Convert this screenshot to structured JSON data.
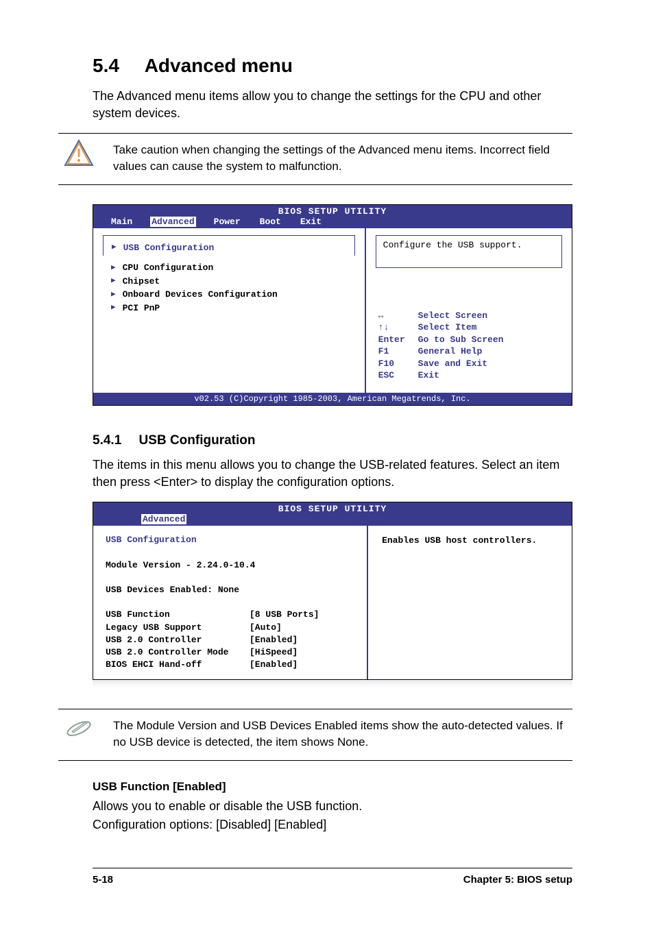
{
  "heading": {
    "num": "5.4",
    "title": "Advanced menu"
  },
  "intro": "The Advanced menu items allow you to change the settings for the CPU and other system devices.",
  "caution": "Take caution when changing the settings of the Advanced menu items. Incorrect field values can cause the system to malfunction.",
  "bios1": {
    "title": "BIOS SETUP UTILITY",
    "tabs": [
      "Main",
      "Advanced",
      "Power",
      "Boot",
      "Exit"
    ],
    "active_tab": "Advanced",
    "items": [
      "USB Configuration",
      "CPU Configuration",
      "Chipset",
      "Onboard Devices Configuration",
      "PCI PnP"
    ],
    "help_text": "Configure the USB support.",
    "keys": [
      {
        "k": "↔",
        "v": "Select Screen"
      },
      {
        "k": "↑↓",
        "v": "Select Item"
      },
      {
        "k": "Enter",
        "v": "Go to Sub Screen"
      },
      {
        "k": "F1",
        "v": "General Help"
      },
      {
        "k": "F10",
        "v": "Save and Exit"
      },
      {
        "k": "ESC",
        "v": "Exit"
      }
    ],
    "footer": "v02.53 (C)Copyright 1985-2003, American Megatrends, Inc."
  },
  "sub1": {
    "num": "5.4.1",
    "title": "USB Configuration"
  },
  "sub1_text": "The items in this menu allows you to change the USB-related features. Select an item then press <Enter> to display the configuration options.",
  "bios2": {
    "title": "BIOS SETUP UTILITY",
    "tab": "Advanced",
    "header": "USB Configuration",
    "lines": [
      "Module Version - 2.24.0-10.4",
      "USB Devices Enabled: None"
    ],
    "settings": [
      {
        "k": "USB Function",
        "v": "[8 USB Ports]"
      },
      {
        "k": "Legacy USB Support",
        "v": "[Auto]"
      },
      {
        "k": "USB 2.0 Controller",
        "v": "[Enabled]"
      },
      {
        "k": "USB 2.0 Controller Mode",
        "v": "[HiSpeed]"
      },
      {
        "k": "BIOS EHCI Hand-off",
        "v": "[Enabled]"
      }
    ],
    "help_text": "Enables USB host controllers."
  },
  "note": "The Module Version and USB Devices Enabled items show the auto-detected values. If no USB device is detected, the item shows None.",
  "opt1": {
    "title": "USB Function [Enabled]",
    "l1": "Allows you to enable or disable the USB function.",
    "l2": "Configuration options: [Disabled] [Enabled]"
  },
  "footer": {
    "left": "5-18",
    "right": "Chapter 5: BIOS setup"
  }
}
